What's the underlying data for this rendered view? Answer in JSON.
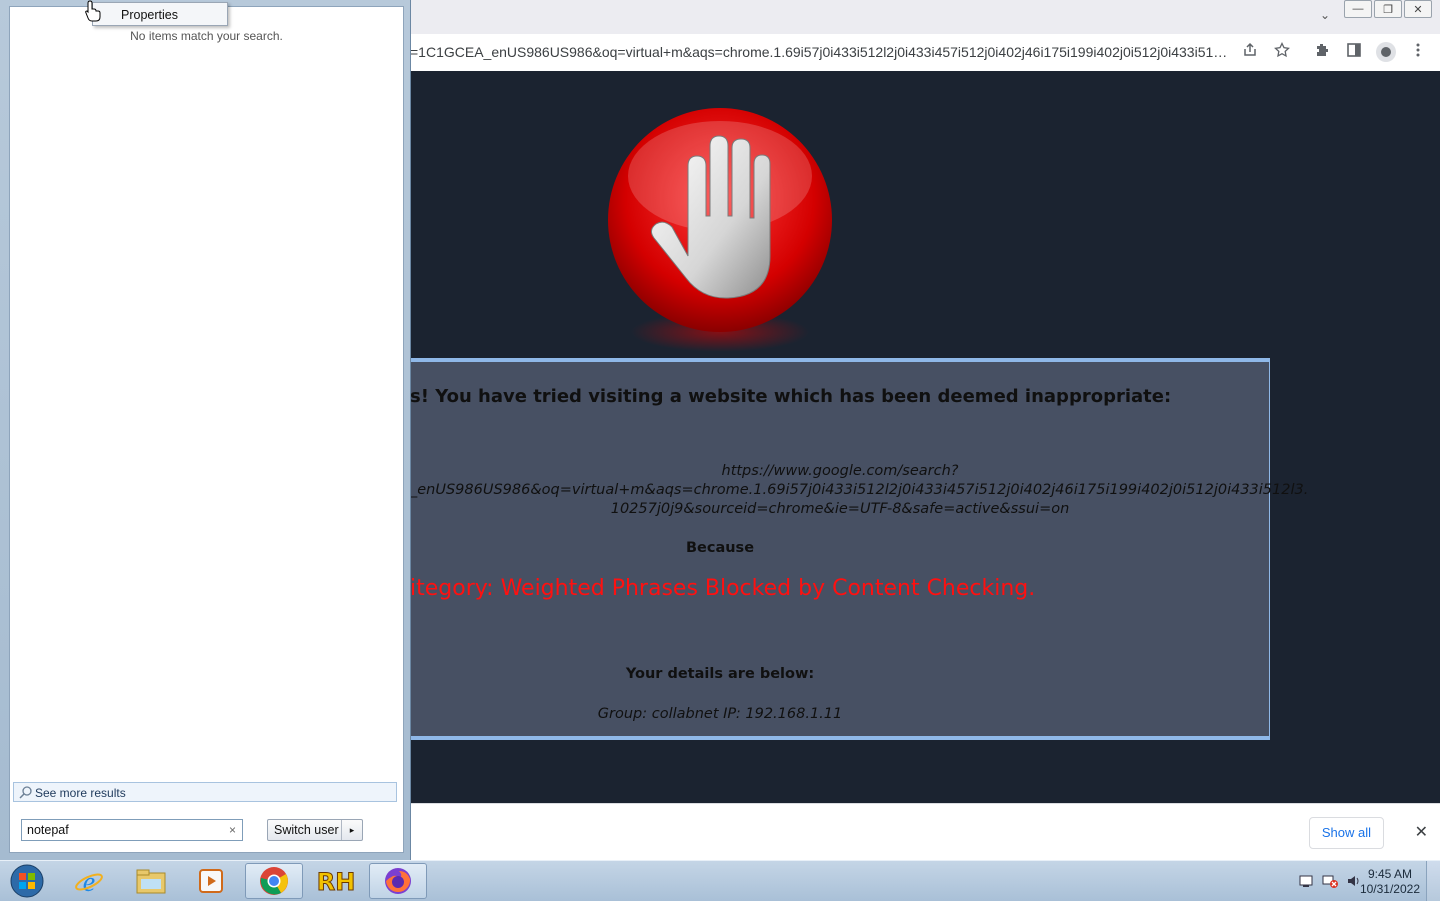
{
  "browser": {
    "address_text": "=1C1GCEA_enUS986US986&oq=virtual+m&aqs=chrome.1.69i57j0i433i512l2j0i433i457i512j0i402j46i175i199i402j0i512j0i433i512l3...",
    "download_bar": {
      "show_all_label": "Show all",
      "close_glyph": "✕"
    },
    "window_controls": {
      "minimize": "—",
      "restore": "❐",
      "close": "✕"
    },
    "tab_dropdown_glyph": "⌄"
  },
  "blocked_page": {
    "headline": "s! You have tried visiting a website which has been deemed inappropriate:",
    "url_lines": [
      "https://www.google.com/search?",
      "_enUS986US986&oq=virtual+m&aqs=chrome.1.69i57j0i433i512l2j0i433i457i512j0i402j46i175i199i402j0i512j0i433i512l3.",
      "10257j0j9&sourceid=chrome&ie=UTF-8&safe=active&ssui=on"
    ],
    "because_label": "Because",
    "reason": "itegory: Weighted Phrases  Blocked by Content Checking.",
    "details_heading": "Your details are below:",
    "details": "Group: collabnet    IP: 192.168.1.11",
    "colors": {
      "panel_bg": "#475063",
      "page_bg": "#1b2330",
      "reason": "#ff1010",
      "panel_border": "#8fb8e8"
    }
  },
  "start_menu": {
    "context_menu_item": "Properties",
    "no_items_text": "No items match your search.",
    "see_more_label": "See more results",
    "search_value": "notepaf",
    "search_clear_glyph": "×",
    "switch_user_label": "Switch user",
    "switch_user_arrow": "▸"
  },
  "taskbar": {
    "items": [
      "start-orb",
      "internet-explorer",
      "windows-explorer",
      "media-player",
      "chrome",
      "rh-app",
      "firefox"
    ],
    "active_items": [
      "chrome",
      "firefox"
    ],
    "clock_time": "9:45 AM",
    "clock_date": "10/31/2022"
  }
}
